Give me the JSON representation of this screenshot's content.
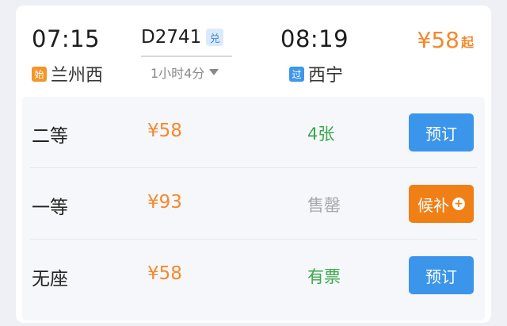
{
  "train": {
    "depart_time": "07:15",
    "depart_station": "兰州西",
    "depart_tag": "始",
    "number": "D2741",
    "number_badge": "兑",
    "duration": "1小时4分",
    "arrive_time": "08:19",
    "arrive_station": "西宁",
    "arrive_tag": "过",
    "price_from": "¥58",
    "price_from_suffix": "起"
  },
  "seats": [
    {
      "class": "二等",
      "price": "¥58",
      "availability": "4张",
      "availability_color": "#3aa84a",
      "button": "预订",
      "button_color": "#3b95ea"
    },
    {
      "class": "一等",
      "price": "¥93",
      "availability": "售罄",
      "availability_color": "#a8a8a8",
      "button": "候补",
      "button_color": "#f07f16",
      "button_icon": "+"
    },
    {
      "class": "无座",
      "price": "¥58",
      "availability": "有票",
      "availability_color": "#3aa84a",
      "button": "预订",
      "button_color": "#3b95ea"
    }
  ],
  "colors": {
    "price": "#f6882b",
    "origin_tag": "#f4962a",
    "pass_tag": "#3f97ea"
  },
  "icons": {
    "duration_toggle": "caret-down-icon",
    "waitlist_add": "plus-circle-icon"
  }
}
